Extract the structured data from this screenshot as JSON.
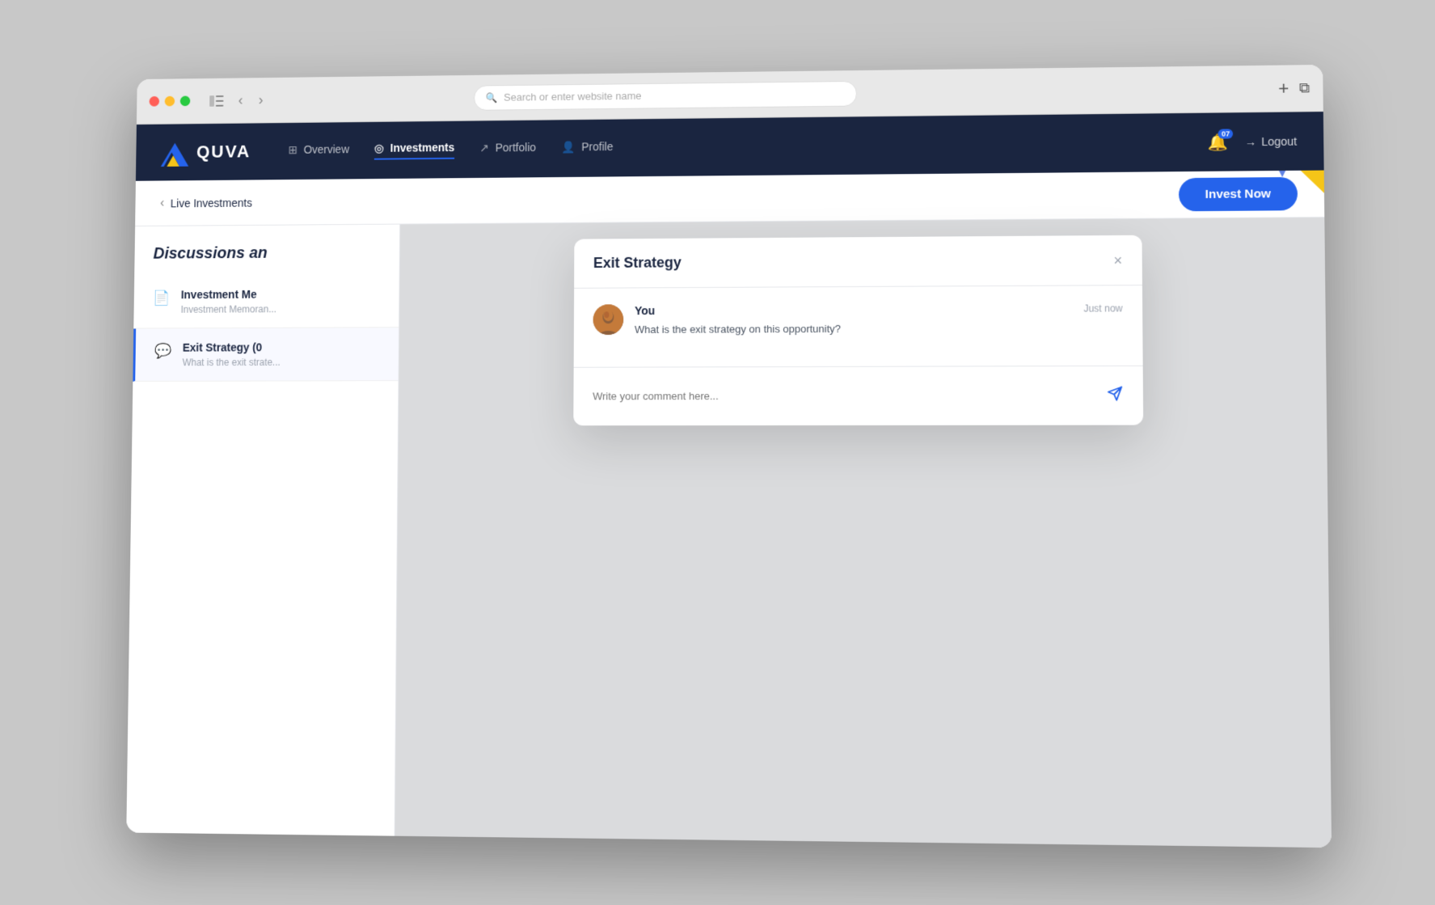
{
  "browser": {
    "address_placeholder": "Search or enter website name",
    "add_tab_icon": "+",
    "windows_icon": "⧉"
  },
  "nav": {
    "logo_text": "QUVA",
    "items": [
      {
        "id": "overview",
        "label": "Overview",
        "active": false,
        "icon": "⊞"
      },
      {
        "id": "investments",
        "label": "Investments",
        "active": true,
        "icon": "((·))"
      },
      {
        "id": "portfolio",
        "label": "Portfolio",
        "active": false,
        "icon": "↗"
      },
      {
        "id": "profile",
        "label": "Profile",
        "active": false,
        "icon": "👤"
      }
    ],
    "notification_count": "07",
    "logout_label": "Logout"
  },
  "sub_nav": {
    "breadcrumb_label": "Live Investments",
    "invest_now_label": "Invest Now"
  },
  "sidebar": {
    "section_title": "Discussions an",
    "items": [
      {
        "id": "investment-memo",
        "icon": "📄",
        "title": "Investment Me",
        "subtitle": "Investment Memoran...",
        "active": false
      },
      {
        "id": "exit-strategy",
        "icon": "💬",
        "title": "Exit Strategy (0",
        "subtitle": "What is the exit strate...",
        "active": true
      }
    ]
  },
  "content_tabs": [
    {
      "id": "tab1",
      "label": "",
      "active": true
    },
    {
      "id": "tab2",
      "label": "",
      "active": false
    },
    {
      "id": "tab3",
      "label": "",
      "active": false
    }
  ],
  "modal": {
    "title": "Exit Strategy",
    "close_icon": "×",
    "comment": {
      "author": "You",
      "time": "Just now",
      "text": "What is the exit strategy on this opportunity?"
    },
    "input_placeholder": "Write your comment here...",
    "send_icon": "✈"
  }
}
